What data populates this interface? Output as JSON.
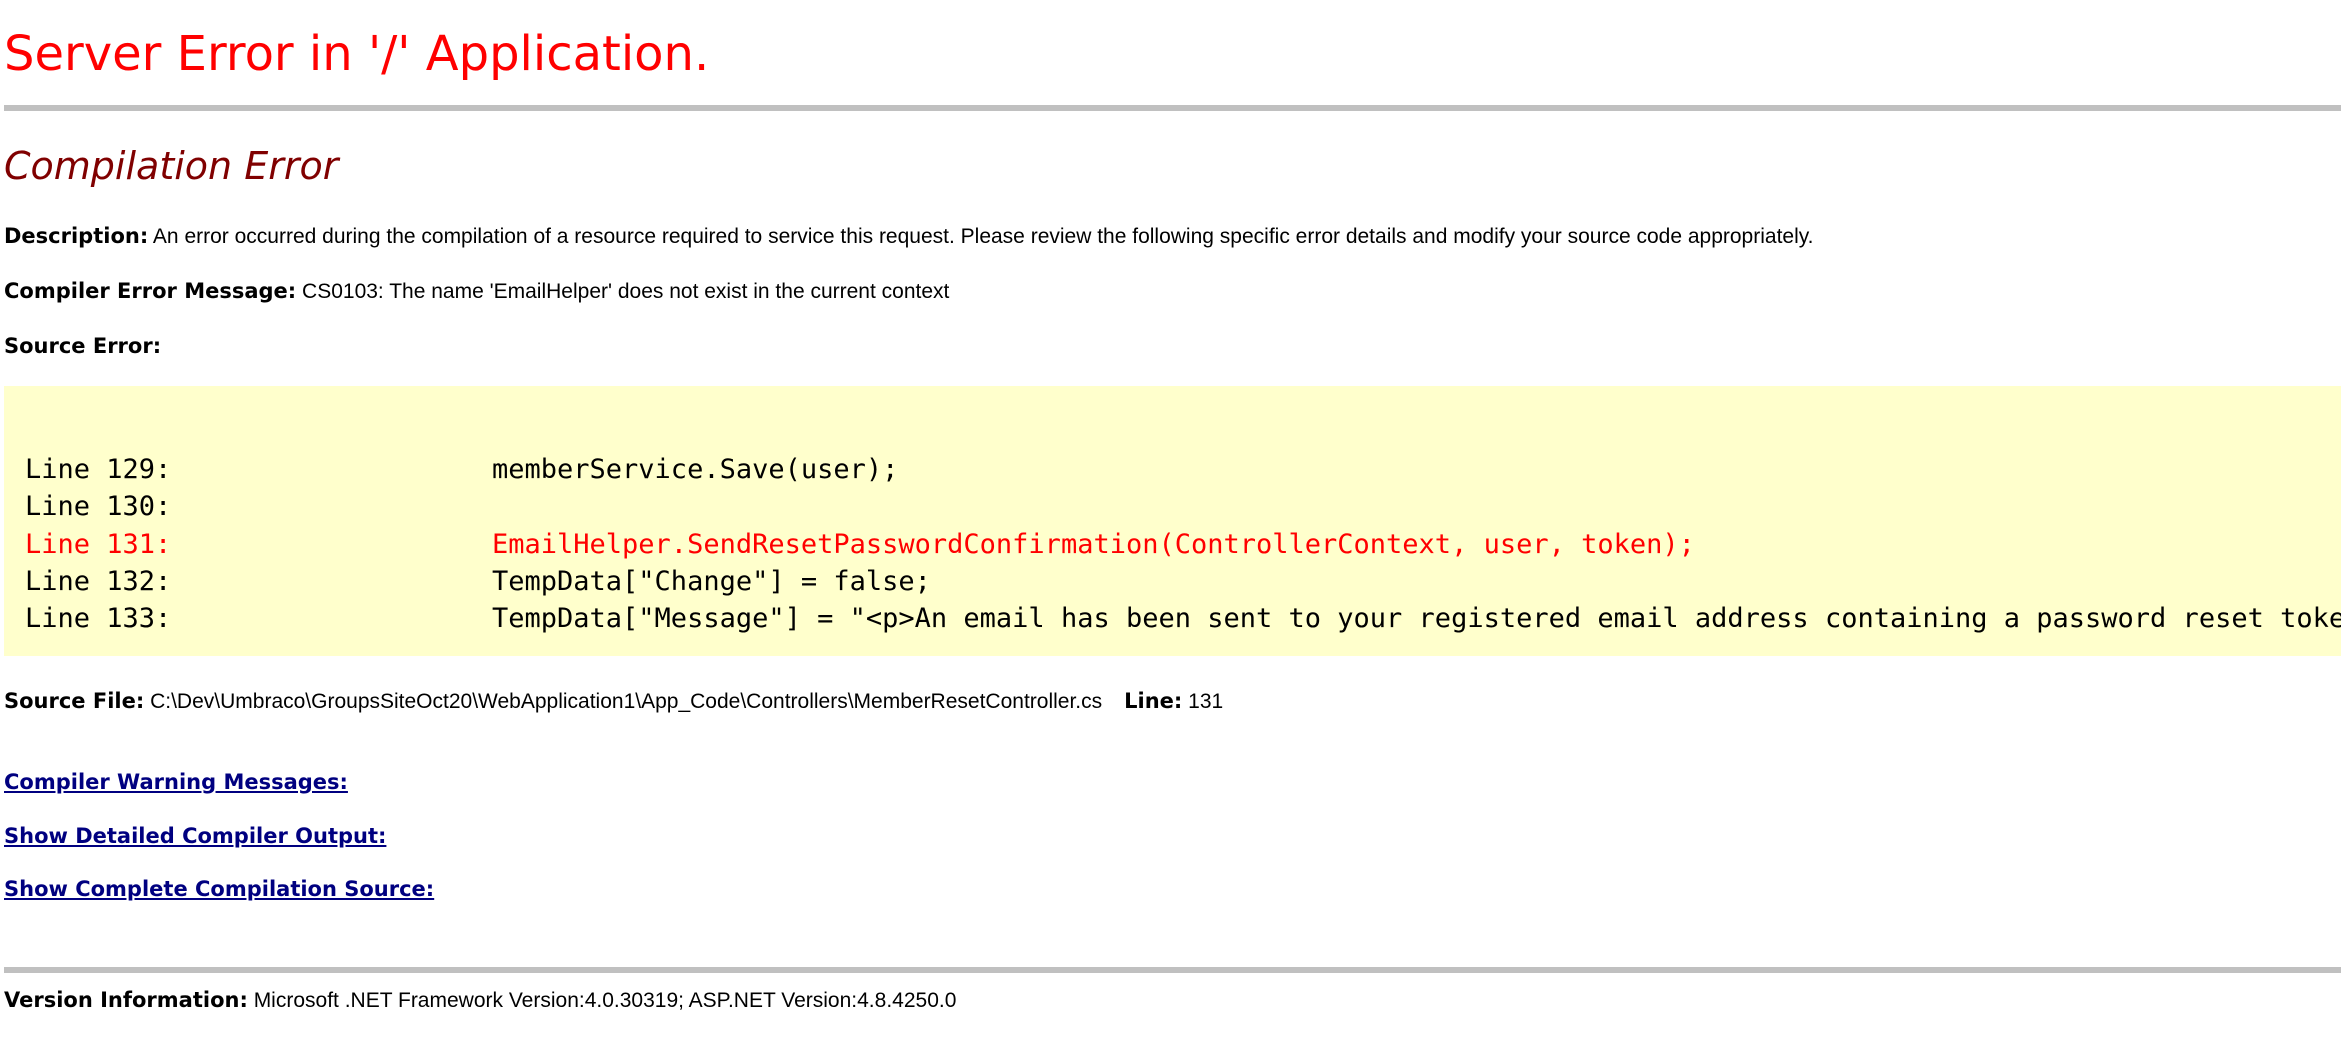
{
  "header": {
    "title": "Server Error in '/' Application."
  },
  "error": {
    "title": "Compilation Error",
    "description": {
      "label": "Description:",
      "text": "An error occurred during the compilation of a resource required to service this request. Please review the following specific error details and modify your source code appropriately."
    },
    "compiler_message": {
      "label": "Compiler Error Message:",
      "text": "CS0103: The name 'EmailHelper' does not exist in the current context"
    },
    "source_error": {
      "label": "Source Error:",
      "lines": [
        {
          "number": "Line 129:",
          "code": "memberService.Save(user);",
          "highlighted": false
        },
        {
          "number": "Line 130:",
          "code": "",
          "highlighted": false
        },
        {
          "number": "Line 131:",
          "code": "EmailHelper.SendResetPasswordConfirmation(ControllerContext, user, token);",
          "highlighted": true
        },
        {
          "number": "Line 132:",
          "code": "TempData[\"Change\"] = false;",
          "highlighted": false
        },
        {
          "number": "Line 133:",
          "code": "TempData[\"Message\"] = \"<p>An email has been sent to your registered email address containing a password reset token",
          "highlighted": false
        }
      ]
    },
    "source_file": {
      "label": "Source File:",
      "path": "C:\\Dev\\Umbraco\\GroupsSiteOct20\\WebApplication1\\App_Code\\Controllers\\MemberResetController.cs",
      "line_label": "Line:",
      "line_value": "131"
    },
    "links": {
      "warnings": "Compiler Warning Messages:",
      "detailed_output": "Show Detailed Compiler Output:",
      "complete_source": "Show Complete Compilation Source:"
    }
  },
  "version": {
    "label": "Version Information:",
    "text": "Microsoft .NET Framework Version:4.0.30319; ASP.NET Version:4.8.4250.0"
  },
  "colors": {
    "app_title": "#ff0000",
    "error_title": "#800000",
    "code_background": "#ffffcc",
    "highlight_line": "#ff0000",
    "link": "#000080",
    "rule": "#c0c0c0"
  }
}
